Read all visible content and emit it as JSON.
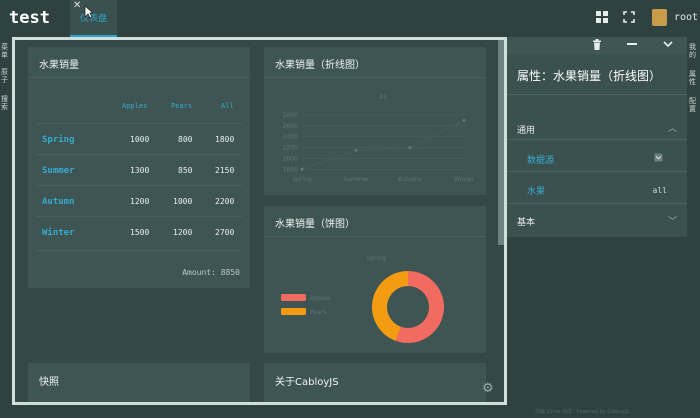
{
  "app": {
    "logo": "test",
    "user": "root"
  },
  "tabs": [
    {
      "label": "仪表盘"
    }
  ],
  "left_rail": {
    "items": [
      "菜单",
      "原子",
      "搜索"
    ]
  },
  "right_rail": {
    "items": [
      "我的",
      "属性",
      "配置"
    ]
  },
  "cards": {
    "table": {
      "title": "水果销量",
      "headers": [
        "Apples",
        "Pears",
        "All"
      ],
      "rows": [
        {
          "season": "Spring",
          "apples": "1000",
          "pears": "800",
          "all": "1800"
        },
        {
          "season": "Summer",
          "apples": "1300",
          "pears": "850",
          "all": "2150"
        },
        {
          "season": "Autumn",
          "apples": "1200",
          "pears": "1000",
          "all": "2200"
        },
        {
          "season": "Winter",
          "apples": "1500",
          "pears": "1200",
          "all": "2700"
        }
      ],
      "amount": "Amount: 8850"
    },
    "line": {
      "title": "水果销量（折线图）"
    },
    "pie": {
      "title": "水果销量（饼图）"
    },
    "snapshot": {
      "title": "快照"
    },
    "about": {
      "title": "关于CabloyJS"
    }
  },
  "chart_data": [
    {
      "type": "line",
      "title": "All",
      "categories": [
        "Spring",
        "Summer",
        "Autumn",
        "Winter"
      ],
      "series": [
        {
          "name": "All",
          "values": [
            1800,
            2150,
            2200,
            2700
          ]
        }
      ],
      "yticks": [
        "2800",
        "2600",
        "2400",
        "2200",
        "2000",
        "1800"
      ],
      "ylim": [
        1750,
        2800
      ],
      "grid": true,
      "color": "#3f5e5d"
    },
    {
      "type": "pie",
      "title": "Spring",
      "series": [
        {
          "name": "Apples",
          "value": 1000,
          "color": "#f16b60"
        },
        {
          "name": "Pears",
          "value": 800,
          "color": "#f39c12"
        }
      ],
      "legend": "left"
    }
  ],
  "properties": {
    "title": "属性：水果销量（折线图）",
    "groups": [
      {
        "label": "通用",
        "expanded": true,
        "items": [
          {
            "label": "数据源",
            "value": ""
          },
          {
            "label": "水果",
            "value": "all"
          }
        ]
      },
      {
        "label": "基本",
        "expanded": false,
        "items": []
      }
    ]
  },
  "footer": {
    "text": "加载 21ms 完成 · Powered by CabloyJS"
  }
}
